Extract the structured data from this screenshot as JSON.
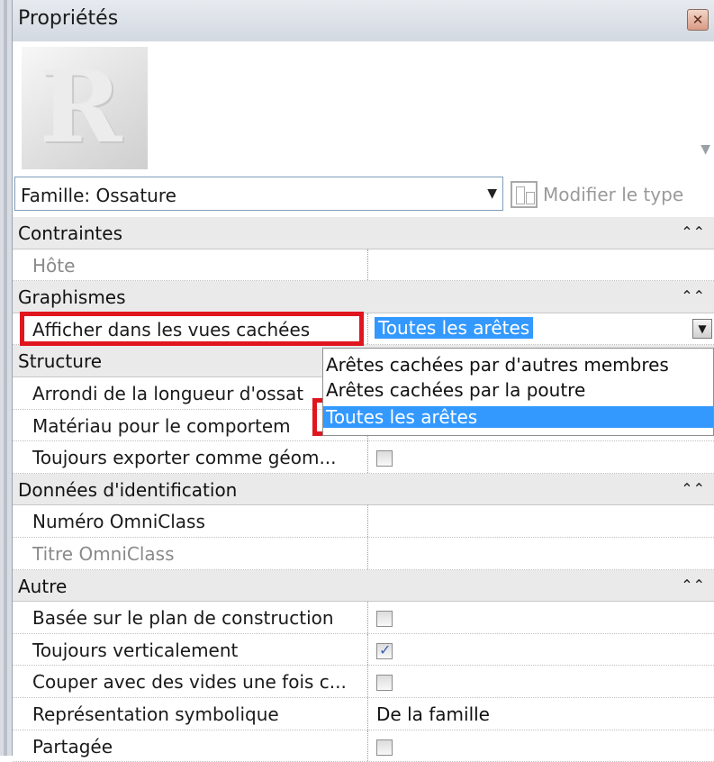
{
  "window": {
    "title": "Propriétés"
  },
  "type_selector": {
    "family": "Famille: Ossature",
    "modify_type_label": "Modifier le type"
  },
  "groups": {
    "contraintes": {
      "label": "Contraintes",
      "params": [
        {
          "name": "Hôte",
          "value": ""
        }
      ]
    },
    "graphismes": {
      "label": "Graphismes",
      "params": [
        {
          "name": "Afficher dans les vues cachées",
          "value": "Toutes les arêtes"
        }
      ]
    },
    "structure": {
      "label": "Structure",
      "params": [
        {
          "name": "Arrondi de la longueur d'ossat",
          "value": ""
        },
        {
          "name": "Matériau pour le comportem",
          "value": ""
        },
        {
          "name": "Toujours exporter comme géom...",
          "checked": false
        }
      ]
    },
    "identification": {
      "label": "Données d'identification",
      "params": [
        {
          "name": "Numéro OmniClass",
          "value": ""
        },
        {
          "name": "Titre OmniClass",
          "value": ""
        }
      ]
    },
    "autre": {
      "label": "Autre",
      "params": [
        {
          "name": "Basée sur le plan de construction",
          "checked": false
        },
        {
          "name": "Toujours verticalement",
          "checked": true
        },
        {
          "name": "Couper avec des vides une fois c...",
          "checked": false
        },
        {
          "name": "Représentation symbolique",
          "value": "De la famille"
        },
        {
          "name": "Partagée",
          "checked": false
        }
      ]
    }
  },
  "dropdown": {
    "options": [
      "Arêtes cachées par d'autres membres",
      "Arêtes cachées par la poutre",
      "Toutes les arêtes"
    ],
    "selected": "Toutes les arêtes"
  },
  "colors": {
    "highlight": "#e0161f",
    "selection": "#3399ff"
  },
  "icons": {
    "close": "close-icon",
    "collapse": "double-chevron-up-icon",
    "dropdown": "chevron-down-icon"
  }
}
